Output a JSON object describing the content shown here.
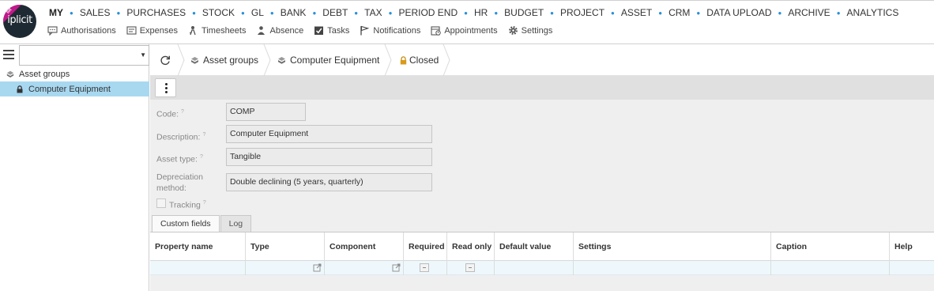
{
  "brand": {
    "logo_text": "iplicit",
    "ribbon_text": "sit"
  },
  "main_nav": [
    "MY",
    "SALES",
    "PURCHASES",
    "STOCK",
    "GL",
    "BANK",
    "DEBT",
    "TAX",
    "PERIOD END",
    "HR",
    "BUDGET",
    "PROJECT",
    "ASSET",
    "CRM",
    "DATA UPLOAD",
    "ARCHIVE",
    "ANALYTICS"
  ],
  "sub_nav": [
    {
      "label": "Authorisations",
      "icon": "chat-icon"
    },
    {
      "label": "Expenses",
      "icon": "expenses-icon"
    },
    {
      "label": "Timesheets",
      "icon": "timesheet-icon"
    },
    {
      "label": "Absence",
      "icon": "absence-icon"
    },
    {
      "label": "Tasks",
      "icon": "tasks-icon"
    },
    {
      "label": "Notifications",
      "icon": "flag-icon"
    },
    {
      "label": "Appointments",
      "icon": "calendar-icon"
    },
    {
      "label": "Settings",
      "icon": "gear-icon"
    }
  ],
  "sidebar": {
    "search_value": "",
    "tree": {
      "root": "Asset groups",
      "child": "Computer Equipment"
    }
  },
  "breadcrumb": {
    "items": [
      "Asset groups",
      "Computer Equipment"
    ],
    "status": "Closed"
  },
  "form": {
    "code_label": "Code:",
    "code_value": "COMP",
    "description_label": "Description:",
    "description_value": "Computer Equipment",
    "asset_type_label": "Asset type:",
    "asset_type_value": "Tangible",
    "depreciation_label_line1": "Depreciation",
    "depreciation_label_line2": "method:",
    "depreciation_value": "Double declining (5 years, quarterly)",
    "tracking_label": "Tracking",
    "help_mark": "?"
  },
  "tabs": [
    "Custom fields",
    "Log"
  ],
  "grid": {
    "columns": [
      "Property name",
      "Type",
      "Component",
      "Required",
      "Read only",
      "Default value",
      "Settings",
      "Caption",
      "Help"
    ]
  },
  "colors": {
    "accent_blue": "#2a8fd6",
    "selected_row": "#a8d8f0",
    "ribbon_magenta": "#c2188c",
    "logo_dark": "#1e2a33",
    "lock_gold": "#d89b1a"
  }
}
